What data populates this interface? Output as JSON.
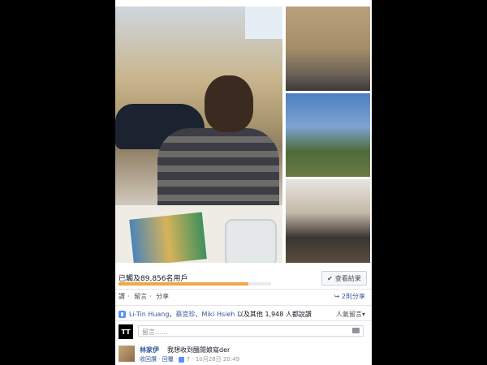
{
  "poll": {
    "progress_text": "已觸及89,856名用戶",
    "progress_fraction": 0.85,
    "results_label": "查看結果",
    "check_icon": "check-icon"
  },
  "actions": {
    "like": "讚",
    "comment": "留言",
    "share": "分享",
    "separator": "·",
    "share_count": "2則分享"
  },
  "likes": {
    "name1": "Li-Tin Huang",
    "sep1": "、",
    "name2": "蔡宜珍",
    "sep2": "、",
    "name3": "Miki Hsieh",
    "rest": " 以及其他 1,948 人都說讚",
    "popular": "人氣留言▾"
  },
  "comment_box": {
    "avatar_text": "TT",
    "placeholder": "留言……"
  },
  "comment": {
    "author": "林家伊",
    "text": "我想收到醞閒娘寫der",
    "reply_action": "收回讚",
    "reply": "回覆",
    "like_count": "7",
    "timestamp": "10月28日 20:49"
  },
  "colors": {
    "accent_link": "#365899",
    "progress": "#f0a74a",
    "like_blue": "#5890ff"
  }
}
